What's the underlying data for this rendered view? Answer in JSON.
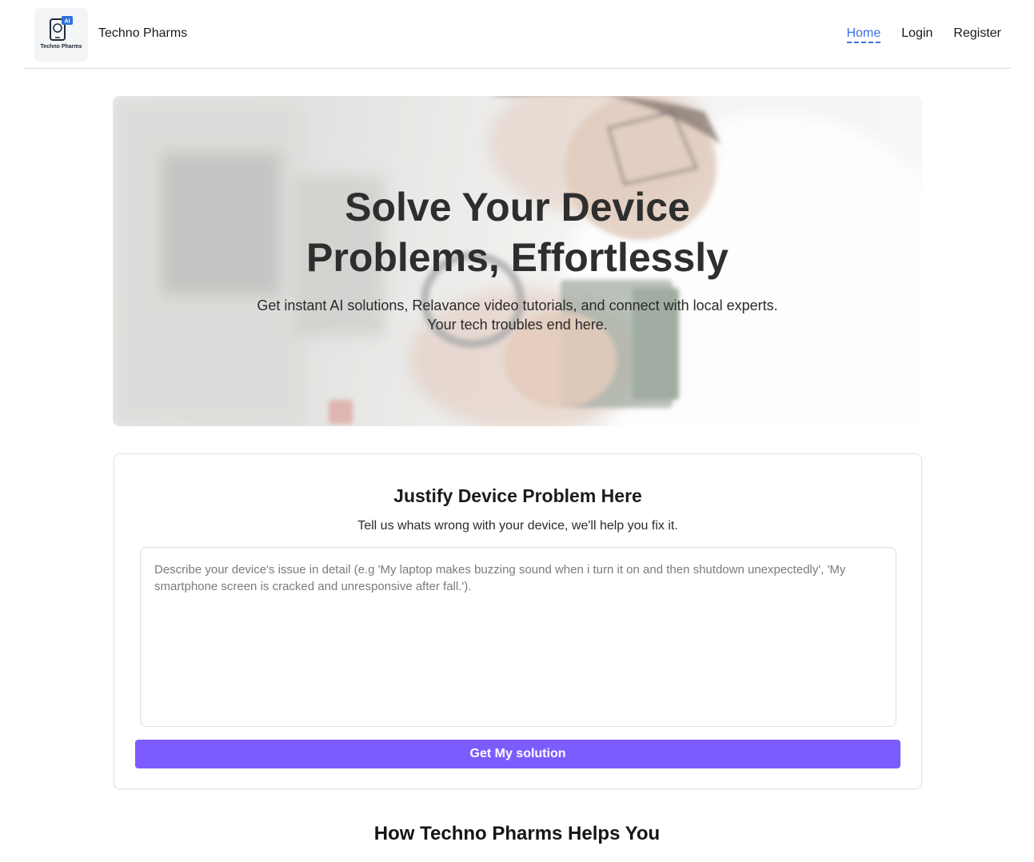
{
  "nav": {
    "logo_caption": "Techno Pharms",
    "logo_badge": "AI",
    "brand": "Techno Pharms",
    "links": [
      {
        "label": "Home",
        "active": true
      },
      {
        "label": "Login",
        "active": false
      },
      {
        "label": "Register",
        "active": false
      }
    ]
  },
  "hero": {
    "title_line1": "Solve Your Device",
    "title_line2": "Problems, Effortlessly",
    "subtitle_line1": "Get instant AI solutions, Relavance video tutorials, and connect with local experts.",
    "subtitle_line2": "Your tech troubles end here."
  },
  "problem_form": {
    "title": "Justify Device Problem Here",
    "subtitle": "Tell us whats wrong with your device, we'll help you fix it.",
    "input_value": "",
    "input_placeholder": "Describe your device's issue in detail (e.g 'My laptop makes buzzing sound when i turn it on and then shutdown unexpectedly', 'My smartphone screen is cracked and unresponsive after fall.').",
    "submit_label": "Get My solution"
  },
  "how_section": {
    "title": "How Techno Pharms Helps You"
  },
  "colors": {
    "accent": "#7c5cff",
    "active_link": "#3b6fe0"
  }
}
